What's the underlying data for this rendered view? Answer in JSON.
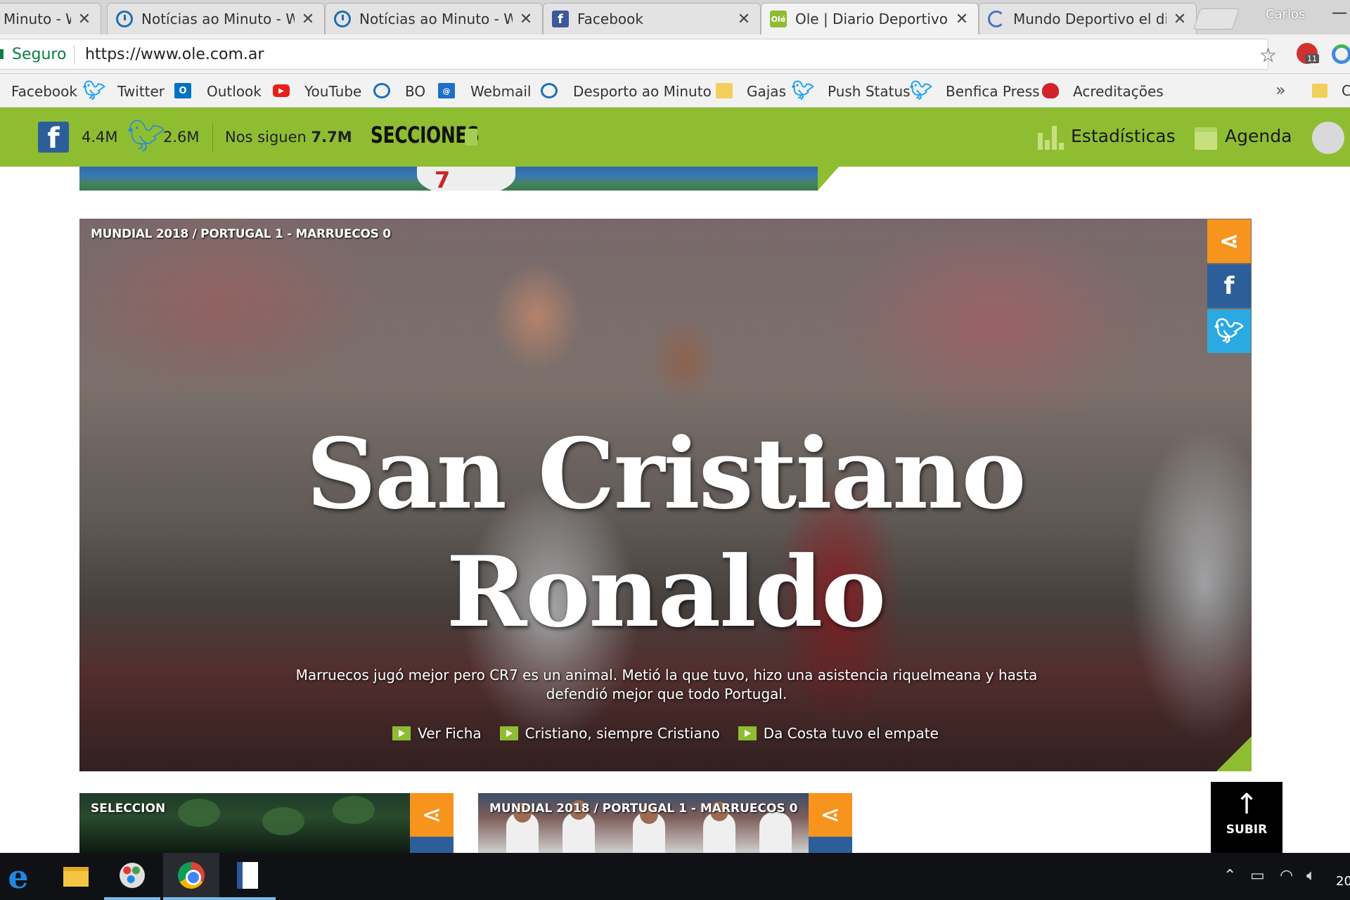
{
  "browser": {
    "tabs": [
      {
        "title": "Minuto - W",
        "favicon": "clock-icon",
        "close": "✕"
      },
      {
        "title": "Notícias ao Minuto - W",
        "favicon": "clock-icon",
        "close": "✕"
      },
      {
        "title": "Notícias ao Minuto - W",
        "favicon": "clock-icon",
        "close": "✕"
      },
      {
        "title": "Facebook",
        "favicon": "facebook-icon",
        "close": "✕"
      },
      {
        "title": "Ole | Diario Deportivo",
        "favicon": "ole-icon",
        "close": "✕"
      },
      {
        "title": "Mundo Deportivo el dia",
        "favicon": "loading-icon",
        "close": "✕"
      }
    ],
    "profile_name": "Carlos",
    "minimize": "—",
    "security_label": "Seguro",
    "url": "https://www.ole.com.ar",
    "bookmarks": [
      "Facebook",
      "Twitter",
      "Outlook",
      "YouTube",
      "BO",
      "Webmail",
      "Desporto ao Minuto",
      "Gajas",
      "Push Status",
      "Benfica Press",
      "Acreditações"
    ],
    "bookmarks_more": "»",
    "bookmarks_trunc": "C",
    "extension_badge": "11"
  },
  "site": {
    "accent_color": "#8fbd32",
    "facebook_followers": "4.4M",
    "twitter_followers": "2.6M",
    "follow_label": "Nos siguen",
    "follow_total": "7.7M",
    "sections_label": "SECCIONES",
    "stats_label": "Estadísticas",
    "agenda_label": "Agenda",
    "scroll_top_label": "SUBIR"
  },
  "hero": {
    "category": "MUNDIAL 2018 / PORTUGAL 1 - MARRUECOS 0",
    "title_line1": "San Cristiano",
    "title_line2": "Ronaldo",
    "subtitle": "Marruecos jugó mejor pero CR7 es un animal. Metió la que tuvo, hizo una asistencia riquelmeana y hasta defendió mejor que todo Portugal.",
    "links": [
      "Ver Ficha",
      "Cristiano, siempre Cristiano",
      "Da Costa tuvo el empate"
    ]
  },
  "cards": [
    {
      "category": "SELECCION"
    },
    {
      "category": "MUNDIAL 2018 / PORTUGAL 1 - MARRUECOS 0"
    }
  ],
  "taskbar": {
    "clock_trunc": "20"
  }
}
